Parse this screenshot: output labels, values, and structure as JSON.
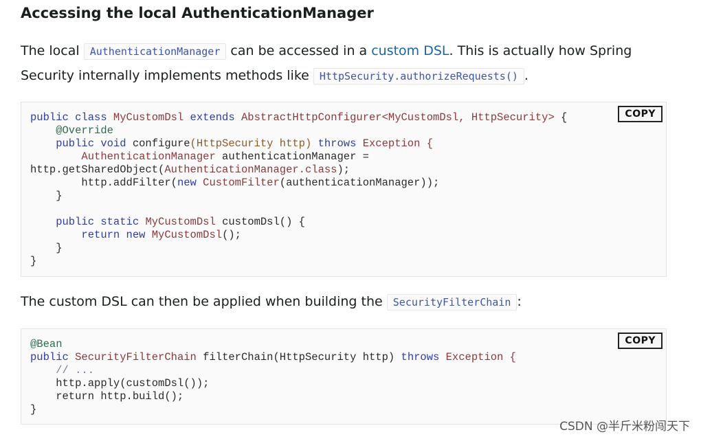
{
  "section": {
    "heading": "Accessing the local AuthenticationManager"
  },
  "paragraph1": {
    "t1": "The local ",
    "code1": "AuthenticationManager",
    "t2": " can be accessed in a ",
    "link": "custom DSL",
    "t3": ". This is actually how Spring Security internally implements methods like ",
    "code2": "HttpSecurity.authorizeRequests()",
    "t4": "."
  },
  "paragraph2": {
    "t1": "The custom DSL can then be applied when building the ",
    "code1": "SecurityFilterChain",
    "t2": ":"
  },
  "code_blocks": {
    "b1": {
      "copy_label": "COPY",
      "l1a": "public class ",
      "l1b": "MyCustomDsl",
      "l1c": " extends ",
      "l1d": "AbstractHttpConfigurer<MyCustomDsl, HttpSecurity>",
      "l1e": " {",
      "l2": "    @Override",
      "l3a": "    public void ",
      "l3b": "configure",
      "l3c": "(HttpSecurity http) ",
      "l3d": "throws",
      "l3e": " Exception {",
      "l4a": "        AuthenticationManager",
      "l4b": " authenticationManager =",
      "l5a": "http.getSharedObject(",
      "l5b": "AuthenticationManager.class",
      "l5c": ");",
      "l6a": "        http.addFilter(",
      "l6b": "new ",
      "l6c": "CustomFilter",
      "l6d": "(authenticationManager));",
      "l7": "    }",
      "l9a": "    public static ",
      "l9b": "MyCustomDsl",
      "l9c": " customDsl() {",
      "l10a": "        return new ",
      "l10b": "MyCustomDsl",
      "l10c": "();",
      "l11": "    }",
      "l12": "}"
    },
    "b2": {
      "copy_label": "COPY",
      "l1": "@Bean",
      "l2a": "public ",
      "l2b": "SecurityFilterChain",
      "l2c": " filterChain(HttpSecurity http) ",
      "l2d": "throws",
      "l2e": " Exception {",
      "l3": "    // ...",
      "l4": "    http.apply(customDsl());",
      "l5": "    return http.build();",
      "l6": "}"
    }
  },
  "watermark": "CSDN @半斤米粉闯天下"
}
